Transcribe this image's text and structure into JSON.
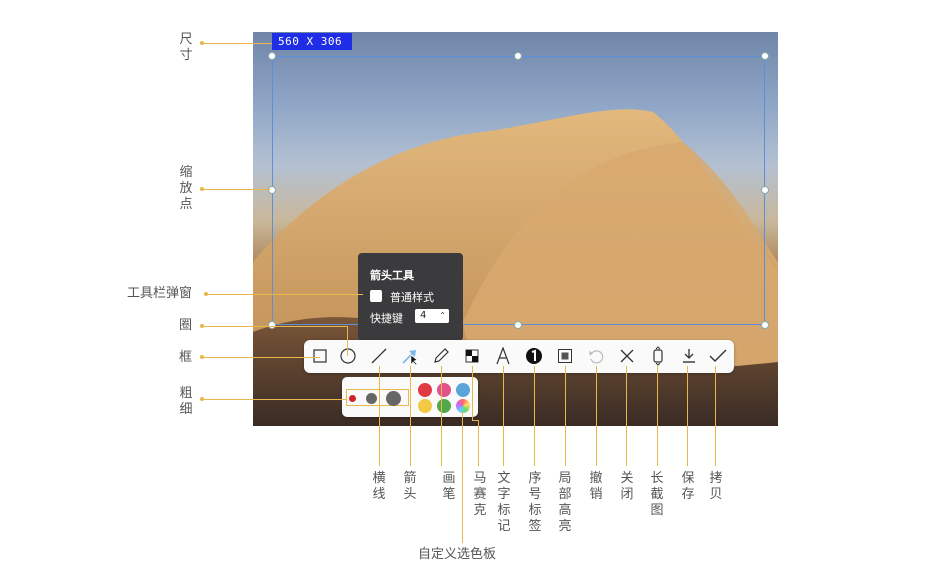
{
  "selection": {
    "size_text": "560  X  306"
  },
  "popup": {
    "title": "箭头工具",
    "checkbox_label": "普通样式",
    "shortcut_label": "快捷键",
    "shortcut_value": "4"
  },
  "toolbar_icons": [
    "rect-icon",
    "circle-icon",
    "line-icon",
    "arrow-icon",
    "pen-icon",
    "mosaic-icon",
    "text-icon",
    "number-icon",
    "highlight-icon",
    "undo-icon",
    "close-icon",
    "long-screenshot-icon",
    "save-icon",
    "copy-icon"
  ],
  "palette": {
    "colors": [
      "#e23a43",
      "#e0528a",
      "#5aa5d8",
      "#f1c945",
      "#54a84a"
    ],
    "custom_color": "custom"
  },
  "left_labels": {
    "size": "尺寸",
    "zoom_point": "缩放点",
    "toolbar_popup": "工具栏弹窗",
    "circle": "圈",
    "box": "框",
    "thickness": "粗细"
  },
  "bottom_labels": {
    "line": "横线",
    "arrow": "箭头",
    "pen": "画笔",
    "mosaic": "马赛克",
    "text": "文字标记",
    "number": "序号标签",
    "highlight": "局部高亮",
    "undo": "撤销",
    "close": "关闭",
    "long": "长截图",
    "save": "保存",
    "copy": "拷贝",
    "custom_palette": "自定义选色板"
  }
}
